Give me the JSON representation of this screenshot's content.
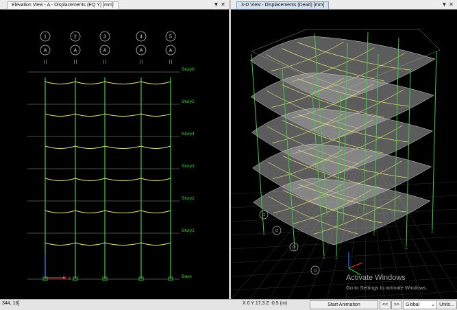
{
  "left_window": {
    "tab_title": "Elevation View - A  -  Displacements (EQ Y)  [mm]",
    "grid_labels": [
      "1",
      "2",
      "3",
      "4",
      "5"
    ],
    "grid_row_label": "A",
    "story_labels": [
      "Story6",
      "Story5",
      "Story4",
      "Story3",
      "Story2",
      "Story1",
      "Base"
    ],
    "axis_label": "Y",
    "pin_glyph": "▼",
    "close_glyph": "✕"
  },
  "right_window": {
    "tab_title": "3-D View  -  Displacements (Dead)  [mm]",
    "pin_glyph": "▼",
    "close_glyph": "✕"
  },
  "status_bar": {
    "cursor_readout": "344, 16]",
    "coordinates": "X 0  Y 17.3  Z -0.5 (m)",
    "start_animation_label": "Start Animation",
    "prev_label": "<<",
    "next_label": ">>",
    "coord_system_value": "Global",
    "units_label": "Units..."
  },
  "watermark": {
    "title": "Activate Windows",
    "subtitle": "Go to Settings to activate Windows."
  },
  "colors": {
    "background": "#000000",
    "column": "#3fcf3f",
    "deformed_beam": "#e6e07a",
    "story_line": "#9a9a9a",
    "story_label": "#2fd82f",
    "slab": "#a8a8a8"
  }
}
